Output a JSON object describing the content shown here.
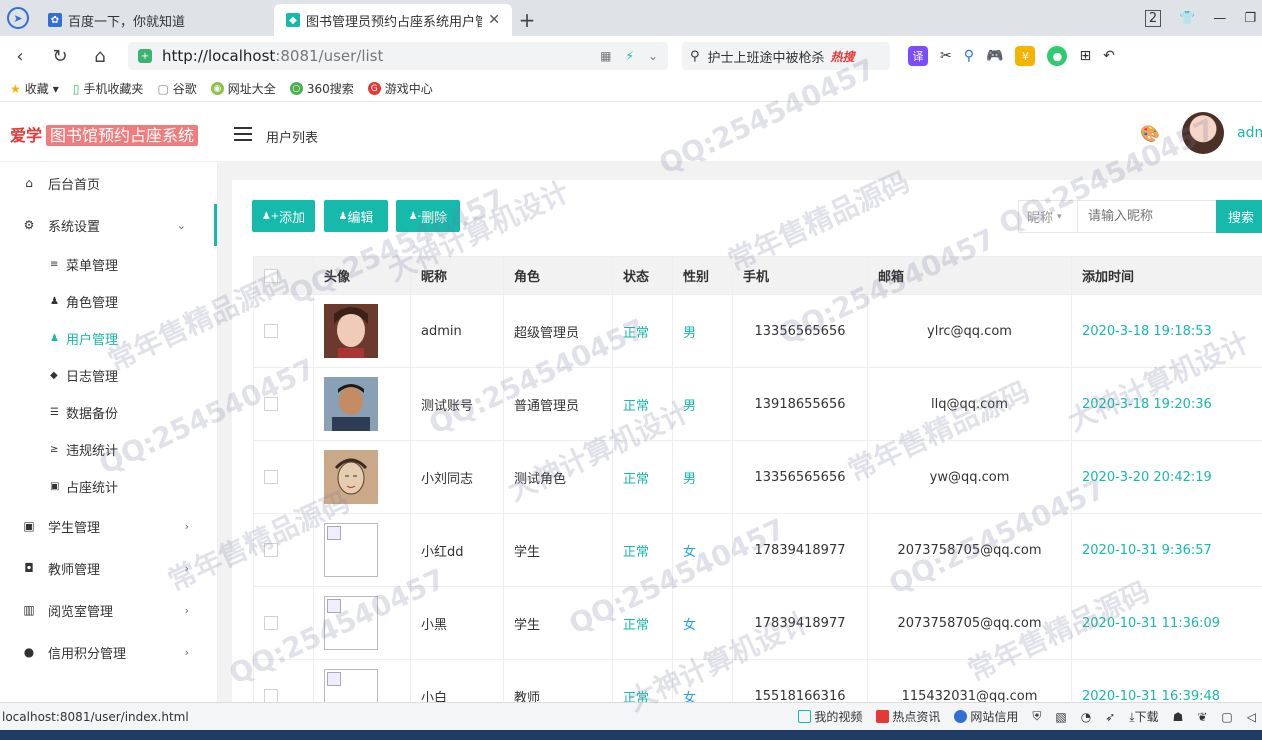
{
  "browser": {
    "tabs": [
      {
        "label": "百度一下，你就知道",
        "active": false
      },
      {
        "label": "图书管理员预约占座系统用户管",
        "active": true
      }
    ],
    "tab_count": "2",
    "url_host": "http://localhost",
    "url_path": ":8081/user/list",
    "search_hint": "护士上班途中被枪杀",
    "search_hot": "热搜",
    "ext_translate": "译",
    "bookmarks": [
      "收藏",
      "手机收藏夹",
      "谷歌",
      "网址大全",
      "360搜索",
      "游戏中心"
    ]
  },
  "app": {
    "logo_main": "爱学",
    "logo_sub": "图书馆预约占座系统",
    "page_title": "用户列表",
    "admin_name": "admin"
  },
  "sidebar": {
    "items": [
      {
        "label": "后台首页",
        "icon": "home-icon"
      },
      {
        "label": "系统设置",
        "icon": "gear-icon",
        "open": true
      },
      {
        "label": "学生管理",
        "icon": "student-icon"
      },
      {
        "label": "教师管理",
        "icon": "teacher-icon"
      },
      {
        "label": "阅览室管理",
        "icon": "book-icon"
      },
      {
        "label": "信用积分管理",
        "icon": "user-icon"
      }
    ],
    "sub_items": [
      {
        "label": "菜单管理",
        "icon": "list-icon"
      },
      {
        "label": "角色管理",
        "icon": "role-icon"
      },
      {
        "label": "用户管理",
        "icon": "users-icon",
        "active": true
      },
      {
        "label": "日志管理",
        "icon": "tag-icon"
      },
      {
        "label": "数据备份",
        "icon": "database-icon"
      },
      {
        "label": "违规统计",
        "icon": "stats-icon"
      },
      {
        "label": "占座统计",
        "icon": "seat-icon"
      }
    ]
  },
  "toolbar": {
    "add": "添加",
    "edit": "编辑",
    "delete": "删除",
    "filter_select": "昵称",
    "search_placeholder": "请输入昵称",
    "search": "搜索"
  },
  "table": {
    "headers": [
      "头像",
      "昵称",
      "角色",
      "状态",
      "性别",
      "手机",
      "邮箱",
      "添加时间"
    ],
    "rows": [
      {
        "nickname": "admin",
        "role": "超级管理员",
        "status": "正常",
        "sex": "男",
        "phone": "13356565656",
        "email": "ylrc@qq.com",
        "time": "2020-3-18 19:18:53",
        "avatar": "photo-woman"
      },
      {
        "nickname": "测试账号",
        "role": "普通管理员",
        "status": "正常",
        "sex": "男",
        "phone": "13918655656",
        "email": "llq@qq.com",
        "time": "2020-3-18 19:20:36",
        "avatar": "photo-man"
      },
      {
        "nickname": "小刘同志",
        "role": "测试角色",
        "status": "正常",
        "sex": "男",
        "phone": "13356565656",
        "email": "yw@qq.com",
        "time": "2020-3-20 20:42:19",
        "avatar": "sketch"
      },
      {
        "nickname": "小红dd",
        "role": "学生",
        "status": "正常",
        "sex": "女",
        "phone": "17839418977",
        "email": "2073758705@qq.com",
        "time": "2020-10-31 9:36:57",
        "avatar": "broken"
      },
      {
        "nickname": "小黑",
        "role": "学生",
        "status": "正常",
        "sex": "女",
        "phone": "17839418977",
        "email": "2073758705@qq.com",
        "time": "2020-10-31 11:36:09",
        "avatar": "broken"
      },
      {
        "nickname": "小白",
        "role": "教师",
        "status": "正常",
        "sex": "女",
        "phone": "15518166316",
        "email": "115432031@qq.com",
        "time": "2020-10-31 16:39:48",
        "avatar": "broken"
      }
    ]
  },
  "statusbar": {
    "url": "localhost:8081/user/index.html",
    "items": [
      "我的视频",
      "热点资讯",
      "网站信用",
      "下载"
    ]
  },
  "watermarks": [
    "QQ:254540457",
    "大神计算机设计",
    "常年售精品源码"
  ],
  "colors": {
    "accent": "#16baaa",
    "female": "#1e9fff",
    "logo": "#e53935"
  }
}
